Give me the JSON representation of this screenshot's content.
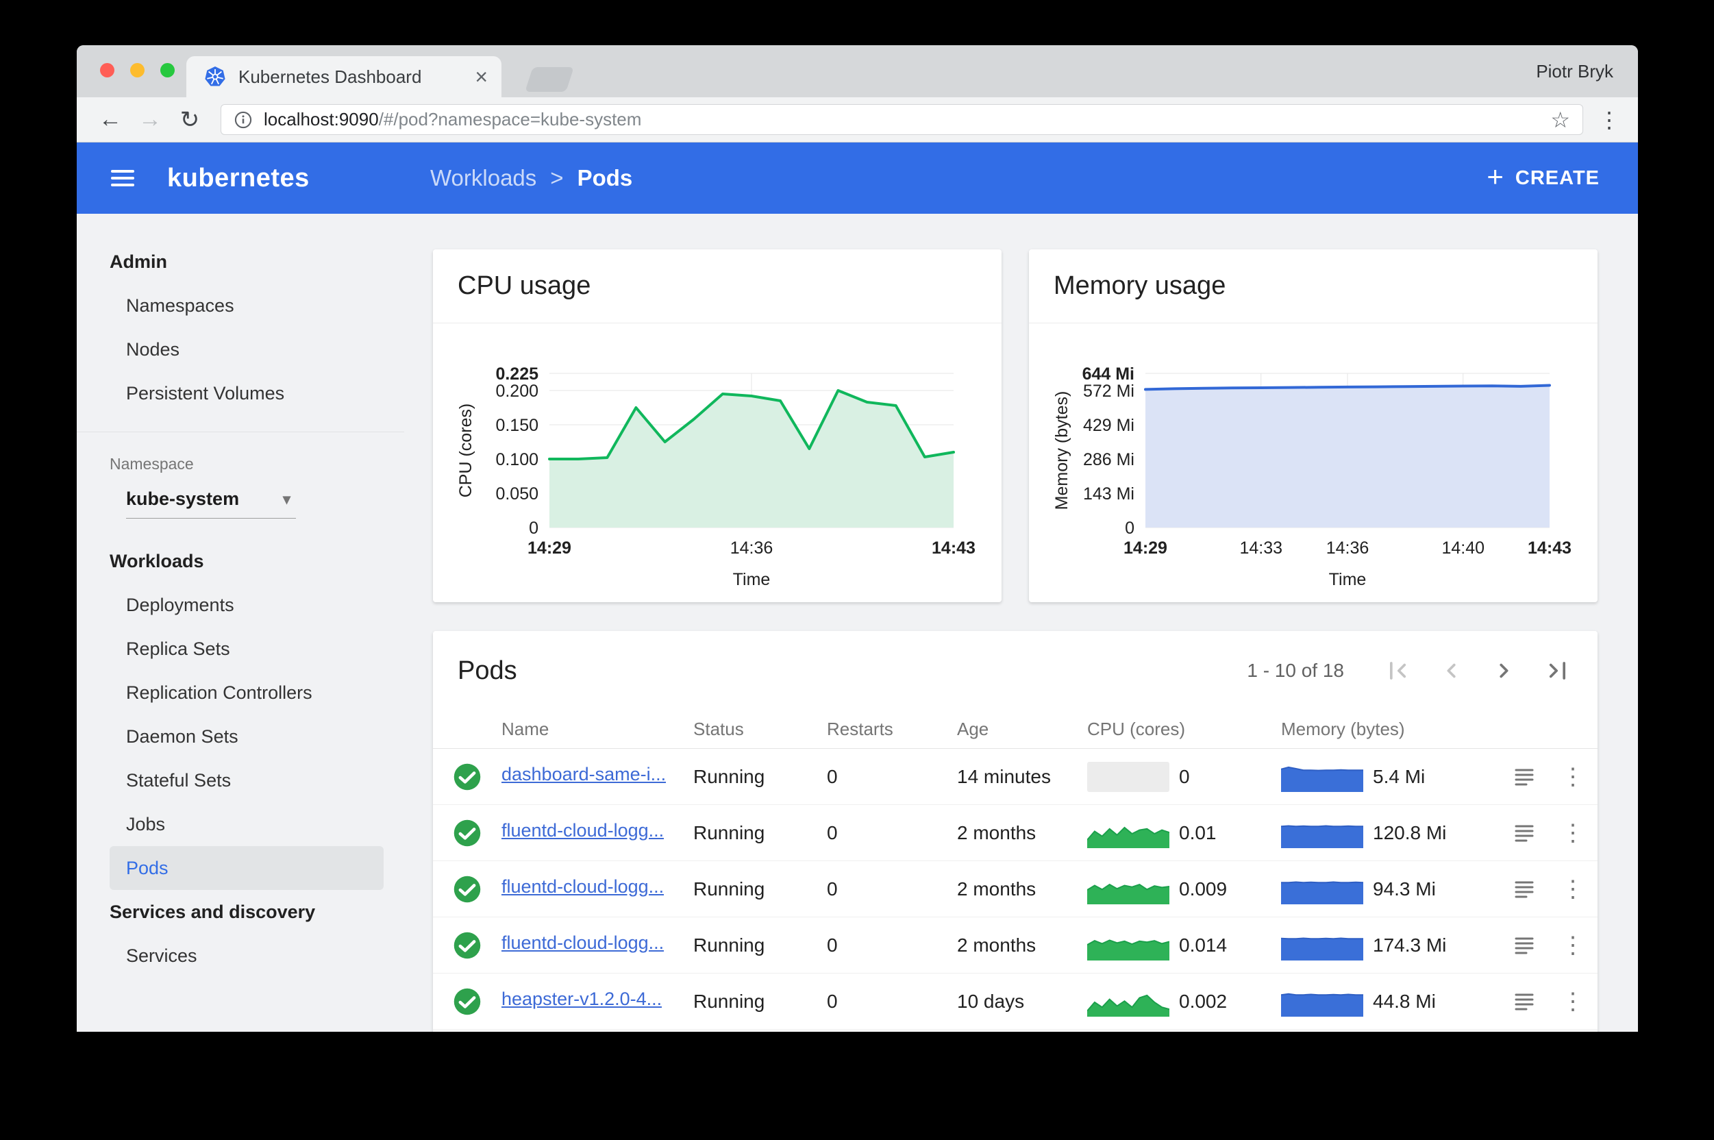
{
  "colors": {
    "header_blue": "#326de6",
    "link_blue": "#3d6ad6",
    "ok_green": "#2ea14c"
  },
  "icons": {
    "back": "←",
    "forward": "→",
    "reload": "↻",
    "star": "☆",
    "overflow_menu": "⋮",
    "close_tab": "×",
    "breadcrumb_chevron": ">",
    "dropdown_caret": "▾",
    "plus": "+"
  },
  "browser": {
    "profile_name": "Piotr Bryk",
    "tab_title": "Kubernetes Dashboard",
    "url_host": "localhost:9090",
    "url_path": "/#/pod?namespace=kube-system"
  },
  "header": {
    "brand": "kubernetes",
    "breadcrumb_parent": "Workloads",
    "breadcrumb_current": "Pods",
    "create_label": "CREATE"
  },
  "sidebar": {
    "admin_header": "Admin",
    "admin_items": [
      "Namespaces",
      "Nodes",
      "Persistent Volumes"
    ],
    "namespace_label": "Namespace",
    "namespace_value": "kube-system",
    "workloads_header": "Workloads",
    "workloads_items": [
      "Deployments",
      "Replica Sets",
      "Replication Controllers",
      "Daemon Sets",
      "Stateful Sets",
      "Jobs",
      "Pods"
    ],
    "selected_item": "Pods",
    "services_header": "Services and discovery",
    "services_items": [
      "Services"
    ]
  },
  "charts": {
    "cpu": {
      "type": "area",
      "title": "CPU usage",
      "ylabel": "CPU (cores)",
      "xlabel": "Time",
      "ymax": 0.225,
      "line_color": "#10b75c",
      "fill_color": "#d9f0e3",
      "yticks": [
        {
          "label": "0.225",
          "value": 0.225,
          "bold": true
        },
        {
          "label": "0.200",
          "value": 0.2
        },
        {
          "label": "0.150",
          "value": 0.15
        },
        {
          "label": "0.100",
          "value": 0.1
        },
        {
          "label": "0.050",
          "value": 0.05
        },
        {
          "label": "0",
          "value": 0
        }
      ],
      "xticks": [
        {
          "label": "14:29",
          "pos": 0,
          "bold": true
        },
        {
          "label": "14:36",
          "pos": 0.5,
          "grid": true
        },
        {
          "label": "14:43",
          "pos": 1,
          "bold": true
        }
      ],
      "values": [
        0.1,
        0.1,
        0.102,
        0.175,
        0.125,
        0.158,
        0.195,
        0.192,
        0.185,
        0.115,
        0.2,
        0.183,
        0.178,
        0.103,
        0.11
      ]
    },
    "memory": {
      "type": "area",
      "title": "Memory usage",
      "ylabel": "Memory (bytes)",
      "xlabel": "Time",
      "ymax": 644,
      "line_color": "#3268d6",
      "fill_color": "#dbe3f6",
      "yticks": [
        {
          "label": "644 Mi",
          "value": 644,
          "bold": true
        },
        {
          "label": "572 Mi",
          "value": 572
        },
        {
          "label": "429 Mi",
          "value": 429
        },
        {
          "label": "286 Mi",
          "value": 286
        },
        {
          "label": "143 Mi",
          "value": 143
        },
        {
          "label": "0",
          "value": 0
        }
      ],
      "xticks": [
        {
          "label": "14:29",
          "pos": 0,
          "bold": true
        },
        {
          "label": "14:33",
          "pos": 0.286,
          "grid": true
        },
        {
          "label": "14:36",
          "pos": 0.5,
          "grid": true
        },
        {
          "label": "14:40",
          "pos": 0.786,
          "grid": true
        },
        {
          "label": "14:43",
          "pos": 1,
          "bold": true
        }
      ],
      "values": [
        577,
        580,
        582,
        583,
        584,
        585,
        586,
        587,
        588,
        589,
        590,
        591,
        592,
        590,
        594
      ]
    }
  },
  "pods": {
    "title": "Pods",
    "pagination_label": "1 - 10 of 18",
    "columns": {
      "name": "Name",
      "status": "Status",
      "restarts": "Restarts",
      "age": "Age",
      "cpu": "CPU (cores)",
      "memory": "Memory (bytes)"
    },
    "rows": [
      {
        "name": "dashboard-same-i...",
        "status": "Running",
        "restarts": "0",
        "age": "14 minutes",
        "cpu": "0",
        "memory": "5.4 Mi",
        "cpu_spark": [],
        "mem_spark": [
          0.84,
          0.92,
          0.86,
          0.8,
          0.8,
          0.79,
          0.8,
          0.8,
          0.81,
          0.8,
          0.8,
          0.8
        ]
      },
      {
        "name": "fluentd-cloud-logg...",
        "status": "Running",
        "restarts": "0",
        "age": "2 months",
        "cpu": "0.01",
        "memory": "120.8 Mi",
        "cpu_spark": [
          0.25,
          0.6,
          0.4,
          0.7,
          0.45,
          0.75,
          0.5,
          0.65,
          0.7,
          0.5,
          0.65,
          0.55
        ],
        "mem_spark": [
          0.8,
          0.82,
          0.8,
          0.81,
          0.8,
          0.8,
          0.82,
          0.8,
          0.8,
          0.81,
          0.8,
          0.8
        ]
      },
      {
        "name": "fluentd-cloud-logg...",
        "status": "Running",
        "restarts": "0",
        "age": "2 months",
        "cpu": "0.009",
        "memory": "94.3 Mi",
        "cpu_spark": [
          0.5,
          0.68,
          0.52,
          0.72,
          0.55,
          0.68,
          0.62,
          0.72,
          0.52,
          0.66,
          0.6,
          0.64
        ],
        "mem_spark": [
          0.8,
          0.8,
          0.82,
          0.8,
          0.81,
          0.8,
          0.8,
          0.82,
          0.8,
          0.8,
          0.81,
          0.8
        ]
      },
      {
        "name": "fluentd-cloud-logg...",
        "status": "Running",
        "restarts": "0",
        "age": "2 months",
        "cpu": "0.014",
        "memory": "174.3 Mi",
        "cpu_spark": [
          0.55,
          0.72,
          0.6,
          0.74,
          0.63,
          0.7,
          0.58,
          0.7,
          0.66,
          0.72,
          0.6,
          0.68
        ],
        "mem_spark": [
          0.81,
          0.8,
          0.8,
          0.82,
          0.8,
          0.8,
          0.81,
          0.8,
          0.82,
          0.8,
          0.8,
          0.8
        ]
      },
      {
        "name": "heapster-v1.2.0-4...",
        "status": "Running",
        "restarts": "0",
        "age": "10 days",
        "cpu": "0.002",
        "memory": "44.8 Mi",
        "cpu_spark": [
          0.15,
          0.5,
          0.3,
          0.62,
          0.35,
          0.55,
          0.3,
          0.68,
          0.78,
          0.5,
          0.3,
          0.22
        ],
        "mem_spark": [
          0.8,
          0.84,
          0.8,
          0.8,
          0.82,
          0.8,
          0.8,
          0.81,
          0.8,
          0.82,
          0.8,
          0.8
        ]
      }
    ]
  }
}
